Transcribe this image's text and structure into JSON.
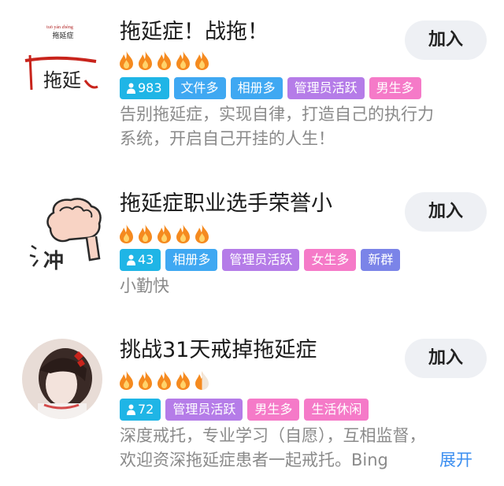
{
  "groups": [
    {
      "title": "拖延症！战拖！",
      "join_label": "加入",
      "flames": 5,
      "members": "983",
      "tags": [
        "文件多",
        "相册多",
        "管理员活跃",
        "男生多"
      ],
      "description": [
        "告别拖延症，实现自律，打造自己的执行力",
        "系统，开启自己开挂的人生！"
      ],
      "avatar_text": "拖延"
    },
    {
      "title": "拖延症职业选手荣誉小",
      "join_label": "加入",
      "flames": 5,
      "members": "43",
      "tags": [
        "相册多",
        "管理员活跃",
        "女生多",
        "新群"
      ],
      "description": [
        "小勤快"
      ],
      "avatar_text": "冲"
    },
    {
      "title": "挑战31天戒掉拖延症",
      "join_label": "加入",
      "flames": 4.5,
      "members": "72",
      "tags": [
        "管理员活跃",
        "男生多",
        "生活休闲"
      ],
      "description": [
        "深度戒托，专业学习（自愿），互相监督，",
        "欢迎资深拖延症患者一起戒托。Bing"
      ],
      "expand_label": "展开"
    }
  ],
  "colors": {
    "members_tag": "#1fb5e6",
    "blue_tag": "#3fa8f2",
    "purple_tag": "#b57ce8",
    "pink_tag": "#f57ac8",
    "indigo_tag": "#7b84e8",
    "flame": "#f58a1f",
    "link": "#3b8ef0"
  }
}
